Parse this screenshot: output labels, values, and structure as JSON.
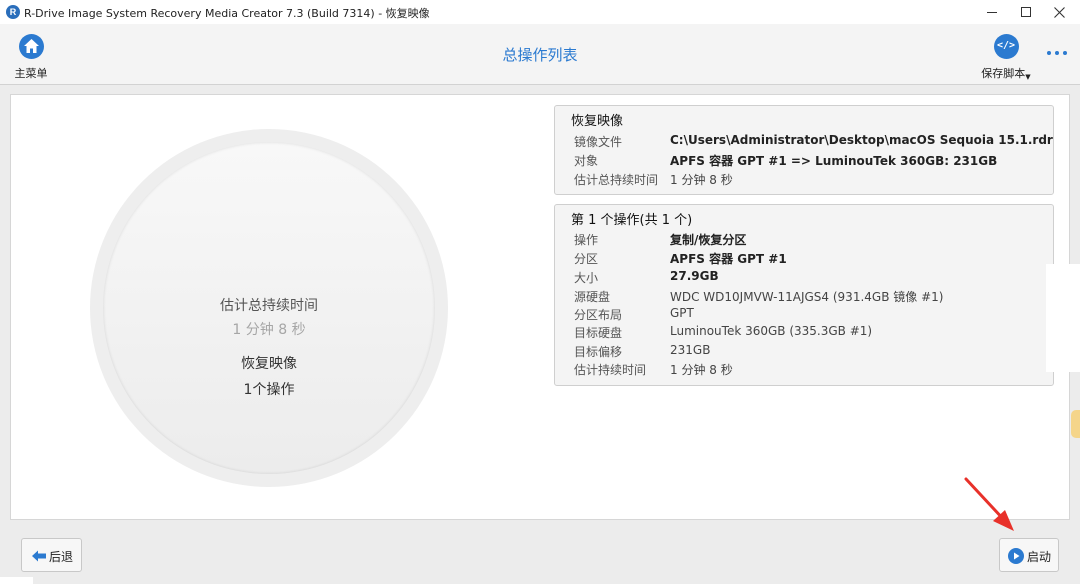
{
  "window": {
    "app_logo_letter": "R",
    "title": "R-Drive Image System Recovery Media Creator 7.3 (Build 7314) - 恢复映像"
  },
  "toolbar": {
    "home_label": "主菜单",
    "page_title": "总操作列表",
    "save_script_label": "保存脚本",
    "save_script_icon_text": "</>"
  },
  "summary": {
    "est_label": "估计总持续时间",
    "est_value": "1 分钟 8 秒",
    "task_name": "恢复映像",
    "op_count": "1个操作"
  },
  "restore_image": {
    "title": "恢复映像",
    "rows": [
      {
        "key": "镜像文件",
        "value": "C:\\Users\\Administrator\\Desktop\\macOS Sequoia 15.1.rdr"
      },
      {
        "key": "对象",
        "value": "APFS 容器 GPT #1  => LuminouTek 360GB: 231GB"
      },
      {
        "key": "估计总持续时间",
        "value": "1 分钟 8 秒"
      }
    ]
  },
  "operation": {
    "title": "第 1 个操作(共 1 个)",
    "rows": [
      {
        "key": "操作",
        "value": "复制/恢复分区"
      },
      {
        "key": "分区",
        "value": "APFS 容器 GPT #1"
      },
      {
        "key": "大小",
        "value": "27.9GB"
      },
      {
        "key": "源硬盘",
        "value": "WDC WD10JMVW-11AJGS4 (931.4GB 镜像 #1)"
      },
      {
        "key": "分区布局",
        "value": "GPT"
      },
      {
        "key": "目标硬盘",
        "value": "LuminouTek 360GB (335.3GB #1)"
      },
      {
        "key": "目标偏移",
        "value": "231GB"
      },
      {
        "key": "估计持续时间",
        "value": "1 分钟 8 秒"
      }
    ]
  },
  "footer": {
    "back_label": "后退",
    "start_label": "启动"
  },
  "colors": {
    "accent": "#2b7ad0",
    "annotation_arrow": "#e8312a"
  }
}
